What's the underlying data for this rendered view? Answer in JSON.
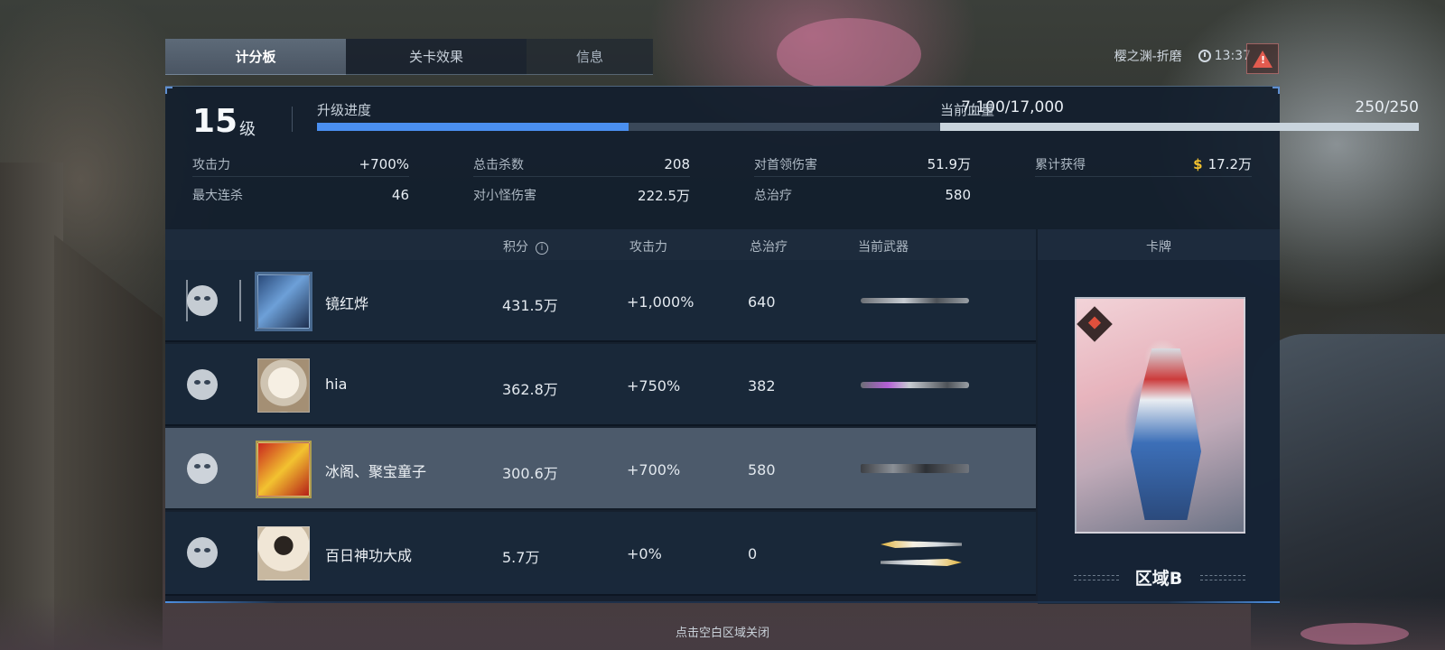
{
  "tabs": [
    {
      "label": "计分板",
      "active": true
    },
    {
      "label": "关卡效果",
      "active": false
    },
    {
      "label": "信息",
      "active": false
    }
  ],
  "header": {
    "map_name": "樱之渊-折磨",
    "clock": "13:37",
    "alert_icon": "warning-triangle-icon"
  },
  "level": {
    "number": "15",
    "unit": "级"
  },
  "progress": {
    "xp_label": "升级进度",
    "xp_value": "7,100/17,000",
    "xp_fraction": 0.4176,
    "hp_label": "当前血量",
    "hp_value": "250/250",
    "hp_fraction": 1.0
  },
  "stats": {
    "attack_label": "攻击力",
    "attack_value": "+700%",
    "max_combo_label": "最大连杀",
    "max_combo_value": "46",
    "total_kills_label": "总击杀数",
    "total_kills_value": "208",
    "minion_damage_label": "对小怪伤害",
    "minion_damage_value": "222.5万",
    "boss_damage_label": "对首领伤害",
    "boss_damage_value": "51.9万",
    "total_heal_label": "总治疗",
    "total_heal_value": "580",
    "earned_label": "累计获得",
    "earned_value": "17.2万",
    "earned_icon": "coin-icon"
  },
  "table": {
    "headers": {
      "score": "积分",
      "attack": "攻击力",
      "heal": "总治疗",
      "weapon": "当前武器"
    },
    "rows": [
      {
        "name": "镜红烨",
        "score": "431.5万",
        "attack": "+1,000%",
        "heal": "640",
        "weapon_icon": "spear-icon",
        "selected": false
      },
      {
        "name": "hia",
        "score": "362.8万",
        "attack": "+750%",
        "heal": "382",
        "weapon_icon": "staff-icon",
        "selected": false
      },
      {
        "name": "冰阁、聚宝童子",
        "score": "300.6万",
        "attack": "+700%",
        "heal": "580",
        "weapon_icon": "rifle-icon",
        "selected": true
      },
      {
        "name": "百日神功大成",
        "score": "5.7万",
        "attack": "+0%",
        "heal": "0",
        "weapon_icon": "dual-knives-icon",
        "selected": false
      }
    ]
  },
  "card": {
    "header": "卡牌",
    "name": "区域B"
  },
  "footer": {
    "hint": "点击空白区域关闭"
  },
  "colors": {
    "xp_bar": "#4a8ff0",
    "hp_bar": "#c9d4dd",
    "coin": "#f2c12e",
    "alert": "#e25b4f"
  }
}
